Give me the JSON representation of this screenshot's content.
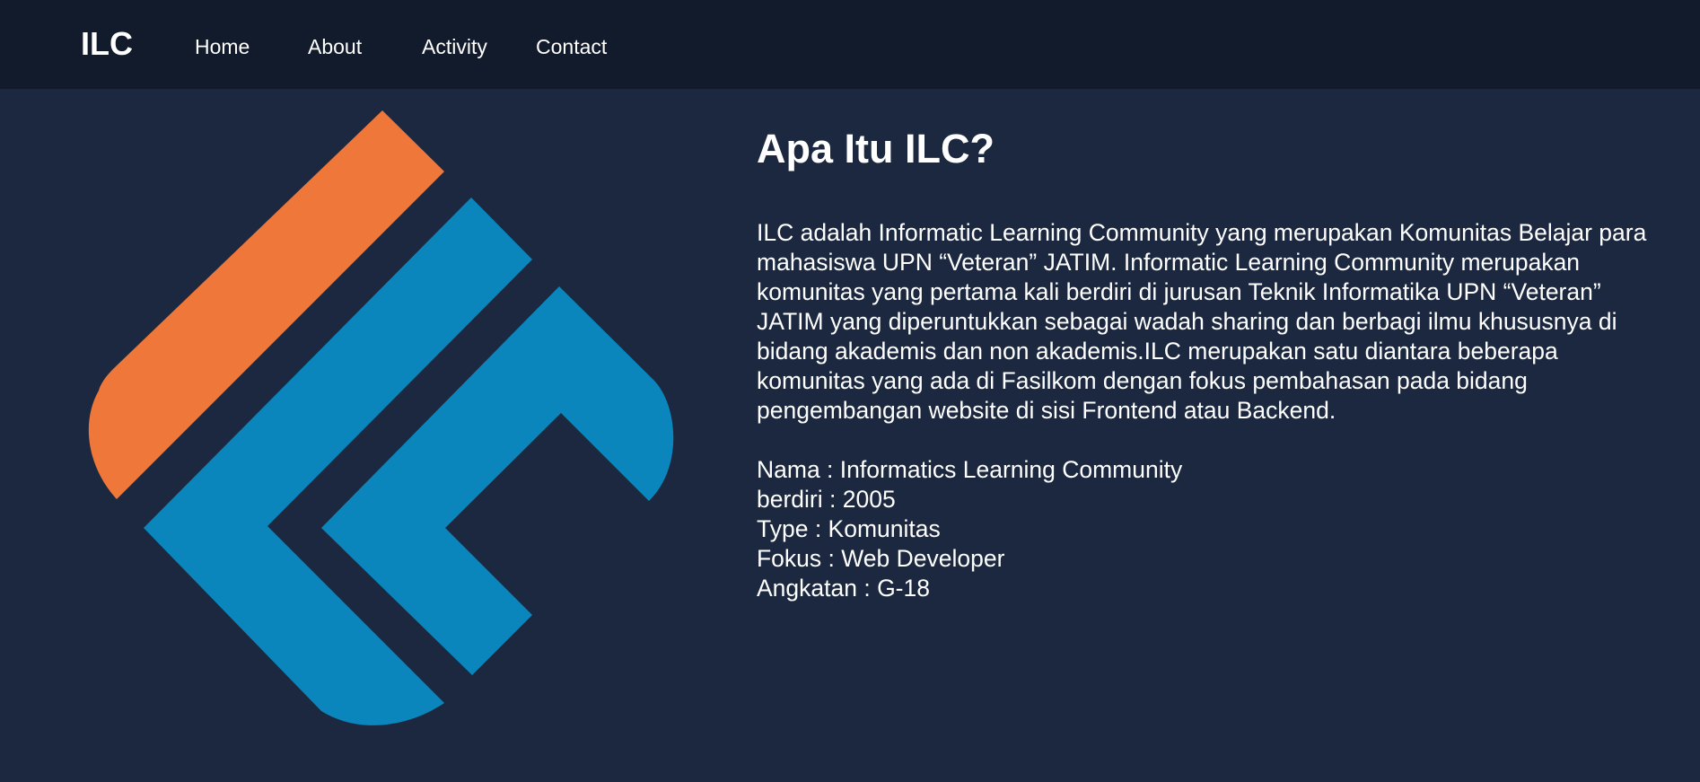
{
  "navbar": {
    "brand": "ILC",
    "links": [
      "Home",
      "About",
      "Activity",
      "Contact"
    ]
  },
  "about": {
    "title": "Apa Itu ILC?",
    "description": "ILC adalah Informatic Learning Community yang merupakan Komunitas Belajar para mahasiswa UPN “Veteran” JATIM. Informatic Learning Community merupakan komunitas yang pertama kali berdiri di jurusan Teknik Informatika UPN “Veteran” JATIM yang diperuntukkan sebagai wadah sharing dan berbagi ilmu khususnya di bidang akademis dan non akademis.ILC merupakan satu diantara beberapa komunitas yang ada di Fasilkom dengan fokus pembahasan pada bidang pengembangan website di sisi Frontend atau Backend.",
    "info": [
      "Nama : Informatics Learning Community",
      "berdiri : 2005",
      "Type : Komunitas",
      "Fokus : Web Developer",
      "Angkatan : G-18"
    ]
  },
  "colors": {
    "navbar_bg": "#121b2b",
    "page_bg": "#1b283f",
    "logo_orange": "#ef773a",
    "logo_blue": "#0a86bc",
    "text": "#ffffff"
  },
  "icons": {
    "logo": "ilc-logo-icon"
  }
}
